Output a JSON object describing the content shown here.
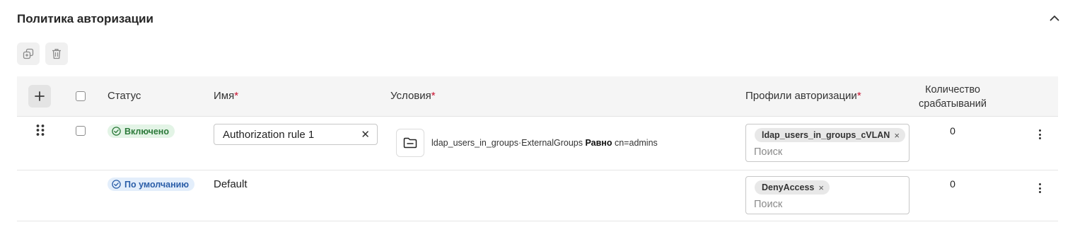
{
  "section": {
    "title": "Политика авторизации"
  },
  "icons": {
    "collapse": "chevron-up-icon",
    "duplicate": "duplicate-icon",
    "delete": "trash-icon",
    "add": "plus-icon",
    "drag": "drag-handle-icon",
    "condition": "folder-icon",
    "status_check": "check-circle-icon",
    "more": "kebab-menu-icon"
  },
  "colors": {
    "enabled_bg": "#e3f4e6",
    "enabled_text": "#2c7a3a",
    "default_bg": "#e3eefb",
    "default_text": "#2b5ea8",
    "required": "#c8102e"
  },
  "table": {
    "columns": {
      "status": "Статус",
      "name": "Имя",
      "conditions": "Условия",
      "profiles": "Профили авторизации",
      "count_line1": "Количество",
      "count_line2": "срабатываний",
      "required_mark": "*"
    },
    "rows": [
      {
        "status": "Включено",
        "name": "Authorization rule 1",
        "condition_attr": "ldap_users_in_groups·ExternalGroups",
        "condition_op": "Равно",
        "condition_value": "cn=admins",
        "profile": "ldap_users_in_groups_cVLAN",
        "profile_remove": "×",
        "search_placeholder": "Поиск",
        "count": "0"
      },
      {
        "status": "По умолчанию",
        "name": "Default",
        "profile": "DenyAccess",
        "profile_remove": "×",
        "search_placeholder": "Поиск",
        "count": "0"
      }
    ]
  }
}
